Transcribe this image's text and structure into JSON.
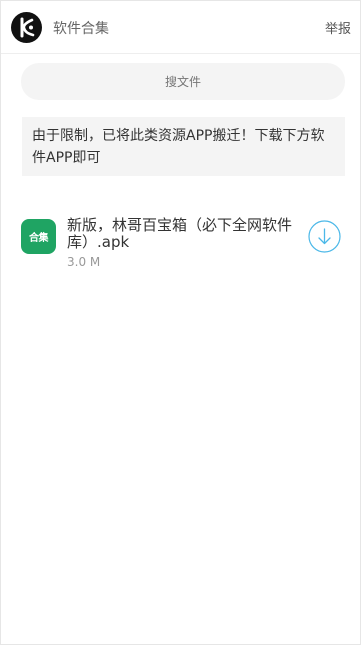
{
  "header": {
    "title": "软件合集",
    "report_label": "举报"
  },
  "search": {
    "placeholder": "搜文件"
  },
  "notice": {
    "text": "由于限制，已将此类资源APP搬迁！下载下方软件APP即可"
  },
  "files": [
    {
      "icon_text": "合集",
      "name": "新版，林哥百宝箱（必下全网软件库）.apk",
      "size": "3.0 M",
      "icon_color": "#1fa463"
    }
  ],
  "colors": {
    "accent": "#4bb8e8",
    "icon_green": "#1fa463"
  },
  "icons": {
    "logo": "brand-logo-icon",
    "download": "download-icon"
  }
}
